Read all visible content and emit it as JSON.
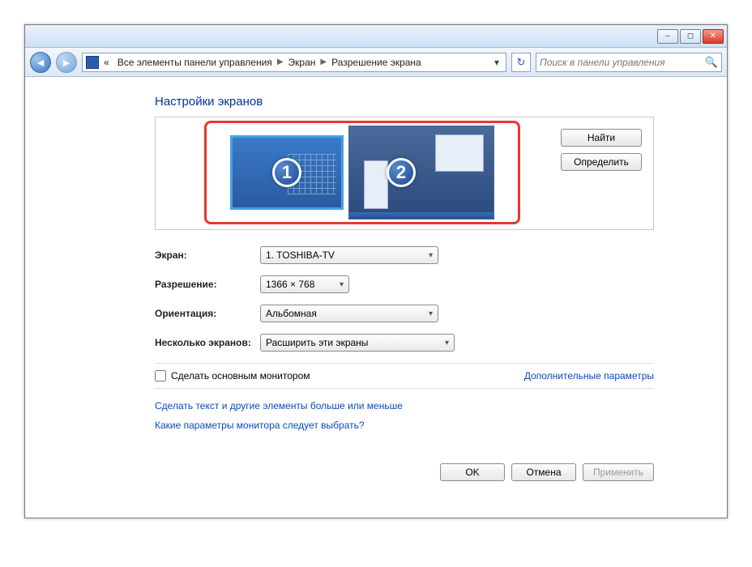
{
  "window": {
    "minimize_icon": "–",
    "maximize_icon": "◻",
    "close_icon": "✕"
  },
  "breadcrumb": {
    "prefix": "«",
    "items": [
      "Все элементы панели управления",
      "Экран",
      "Разрешение экрана"
    ]
  },
  "search": {
    "placeholder": "Поиск в панели управления"
  },
  "page_title": "Настройки экранов",
  "monitors": [
    {
      "number": "1",
      "primary": true
    },
    {
      "number": "2",
      "primary": false
    }
  ],
  "side_buttons": {
    "find": "Найти",
    "identify": "Определить"
  },
  "fields": {
    "screen_label": "Экран:",
    "screen_value": "1. TOSHIBA-TV",
    "resolution_label": "Разрешение:",
    "resolution_value": "1366 × 768",
    "orientation_label": "Ориентация:",
    "orientation_value": "Альбомная",
    "multi_label": "Несколько экранов:",
    "multi_value": "Расширить эти экраны"
  },
  "checkbox": {
    "label": "Сделать основным монитором",
    "checked": false
  },
  "advanced_link": "Дополнительные параметры",
  "links": {
    "text_size": "Сделать текст и другие элементы больше или меньше",
    "help": "Какие параметры монитора следует выбрать?"
  },
  "footer": {
    "ok": "OK",
    "cancel": "Отмена",
    "apply": "Применить"
  }
}
